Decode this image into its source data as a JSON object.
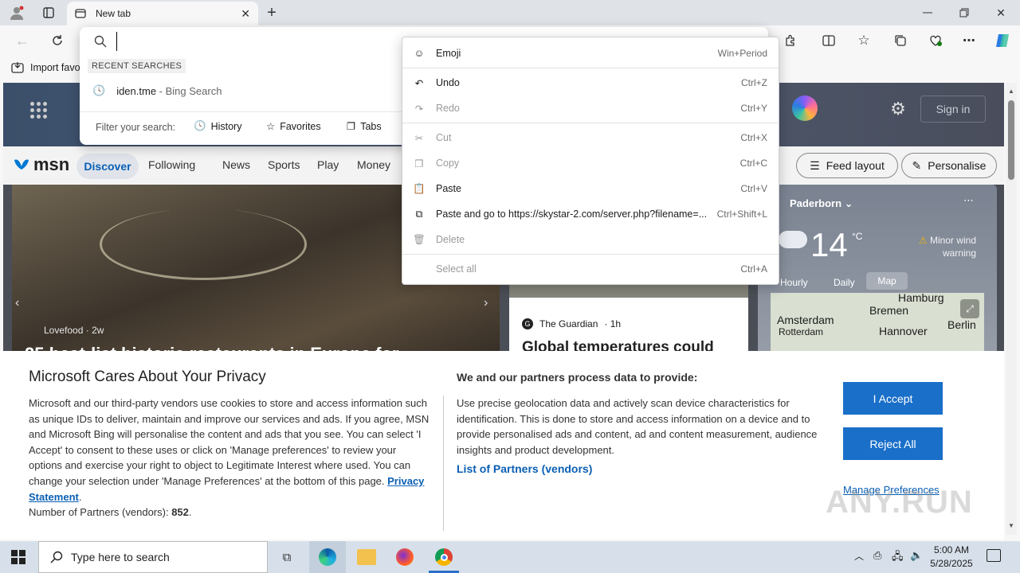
{
  "browser": {
    "tab_title": "New tab",
    "fav_import": "Import favo",
    "colors": {
      "accent": "#1a6fc9",
      "titlebar": "#dfe3e8"
    }
  },
  "omnibox": {
    "value": "",
    "recent_header": "RECENT SEARCHES",
    "recent_item_main": "iden.tme",
    "recent_item_suffix": " - Bing Search",
    "filter_label": "Filter your search:",
    "filters": [
      "History",
      "Favorites",
      "Tabs"
    ]
  },
  "context_menu": {
    "items": [
      {
        "label": "Emoji",
        "shortcut": "Win+Period"
      },
      {
        "label": "Undo",
        "shortcut": "Ctrl+Z"
      },
      {
        "label": "Redo",
        "shortcut": "Ctrl+Y"
      },
      {
        "label": "Cut",
        "shortcut": "Ctrl+X"
      },
      {
        "label": "Copy",
        "shortcut": "Ctrl+C"
      },
      {
        "label": "Paste",
        "shortcut": "Ctrl+V"
      },
      {
        "label": "Paste and go to https://skystar-2.com/server.php?filename=...",
        "shortcut": "Ctrl+Shift+L"
      },
      {
        "label": "Delete",
        "shortcut": ""
      },
      {
        "label": "Select all",
        "shortcut": "Ctrl+A"
      }
    ]
  },
  "msn": {
    "logo": "msn",
    "sign_in": "Sign in",
    "nav": [
      "Discover",
      "Following",
      "News",
      "Sports",
      "Play",
      "Money"
    ],
    "feed_layout": "Feed layout",
    "personalise": "Personalise",
    "hero_source": "Lovefood",
    "hero_age": "2w",
    "hero_headline": "25 best-list historic restaurants in Europe for",
    "card_source": "The Guardian",
    "card_age": "1h",
    "card_headline": "Global temperatures could",
    "weather": {
      "location": "Paderborn",
      "temp": "14",
      "unit": "°C",
      "warning": "Minor wind warning",
      "tabs": [
        "Hourly",
        "Daily",
        "Map"
      ],
      "map_labels": [
        "Hamburg",
        "Bremen",
        "Amsterdam",
        "Hannover",
        "Rotterdam",
        "Berlin"
      ]
    }
  },
  "privacy": {
    "title": "Microsoft Cares About Your Privacy",
    "body": "Microsoft and our third-party vendors use cookies to store and access information such as unique IDs to deliver, maintain and improve our services and ads. If you agree, MSN and Microsoft Bing will personalise the content and ads that you see. You can select 'I Accept' to consent to these uses or click on 'Manage preferences' to review your options and exercise your right to object to Legitimate Interest where used.  You can change your selection under 'Manage Preferences' at the bottom of this page. ",
    "privacy_link": "Privacy Statement",
    "partners_label": "Number of Partners (vendors): ",
    "partners_count": "852",
    "right_title": "We and our partners process data to provide:",
    "right_body": "Use precise geolocation data and actively scan device characteristics for identification. This is done to store and access information on a device and to provide personalised ads and content, ad and content measurement, audience insights and product development.",
    "partners_link": "List of Partners (vendors)",
    "accept": "I Accept",
    "reject": "Reject All",
    "manage": "Manage Preferences"
  },
  "taskbar": {
    "search_placeholder": "Type here to search",
    "time": "5:00 AM",
    "date": "5/28/2025"
  },
  "watermark": "ANY.RUN"
}
